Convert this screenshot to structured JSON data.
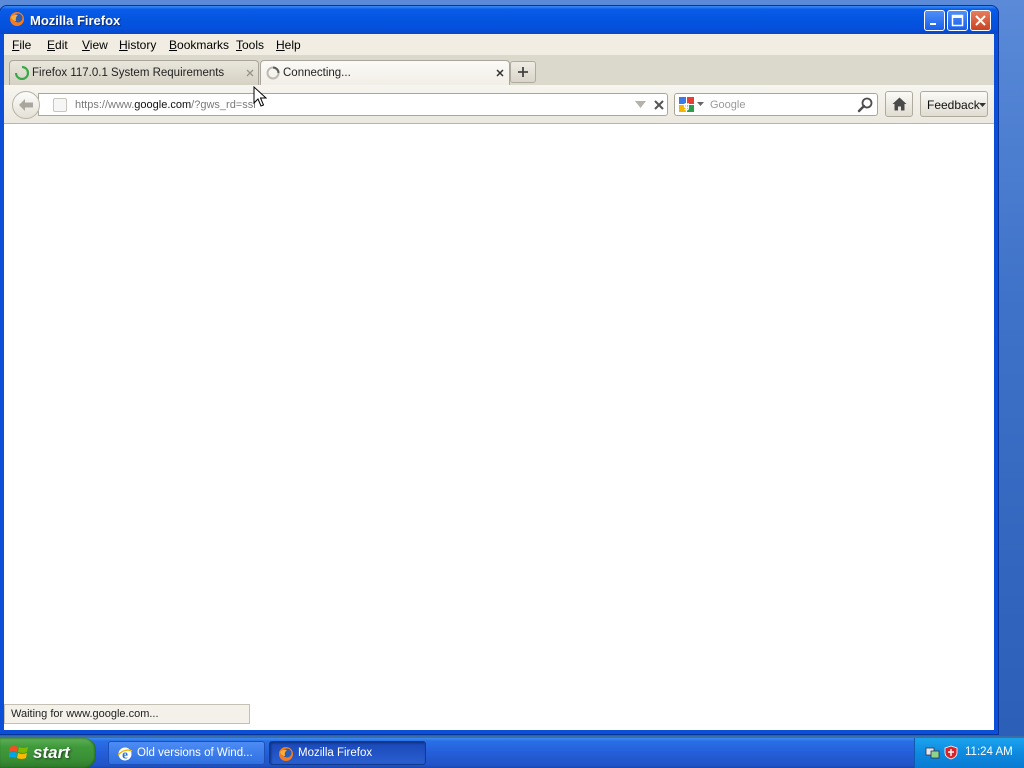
{
  "window": {
    "title": "Mozilla Firefox"
  },
  "menubar": {
    "items": [
      {
        "label": "File",
        "accel": "F",
        "rest": "ile"
      },
      {
        "label": "Edit",
        "accel": "E",
        "rest": "dit"
      },
      {
        "label": "View",
        "accel": "V",
        "rest": "iew"
      },
      {
        "label": "History",
        "accel": "H",
        "rest": "istory"
      },
      {
        "label": "Bookmarks",
        "accel": "B",
        "rest": "ookmarks"
      },
      {
        "label": "Tools",
        "accel": "T",
        "rest": "ools"
      },
      {
        "label": "Help",
        "accel": "H",
        "rest": "elp"
      }
    ]
  },
  "tabs": [
    {
      "label": "Firefox 117.0.1 System Requirements",
      "state": "loading",
      "active": false
    },
    {
      "label": "Connecting...",
      "state": "connecting",
      "active": true
    }
  ],
  "navbar": {
    "url_prefix": "https://www.",
    "url_host": "google.com",
    "url_suffix": "/?gws_rd=ssl",
    "search_placeholder": "Google",
    "search_engine_icon": "google-icon",
    "feedback_label": "Feedback"
  },
  "status": {
    "text": "Waiting for www.google.com..."
  },
  "taskbar": {
    "start_label": "start",
    "tasks": [
      {
        "label": "Old versions of Wind...",
        "icon": "ie-icon",
        "active": false
      },
      {
        "label": "Mozilla Firefox",
        "icon": "firefox-icon",
        "active": true
      }
    ],
    "clock": "11:24 AM"
  },
  "colors": {
    "titlebar": "#0455e0",
    "taskbar": "#245ed8",
    "start": "#3a8f36",
    "tray": "#0e8ae0"
  }
}
